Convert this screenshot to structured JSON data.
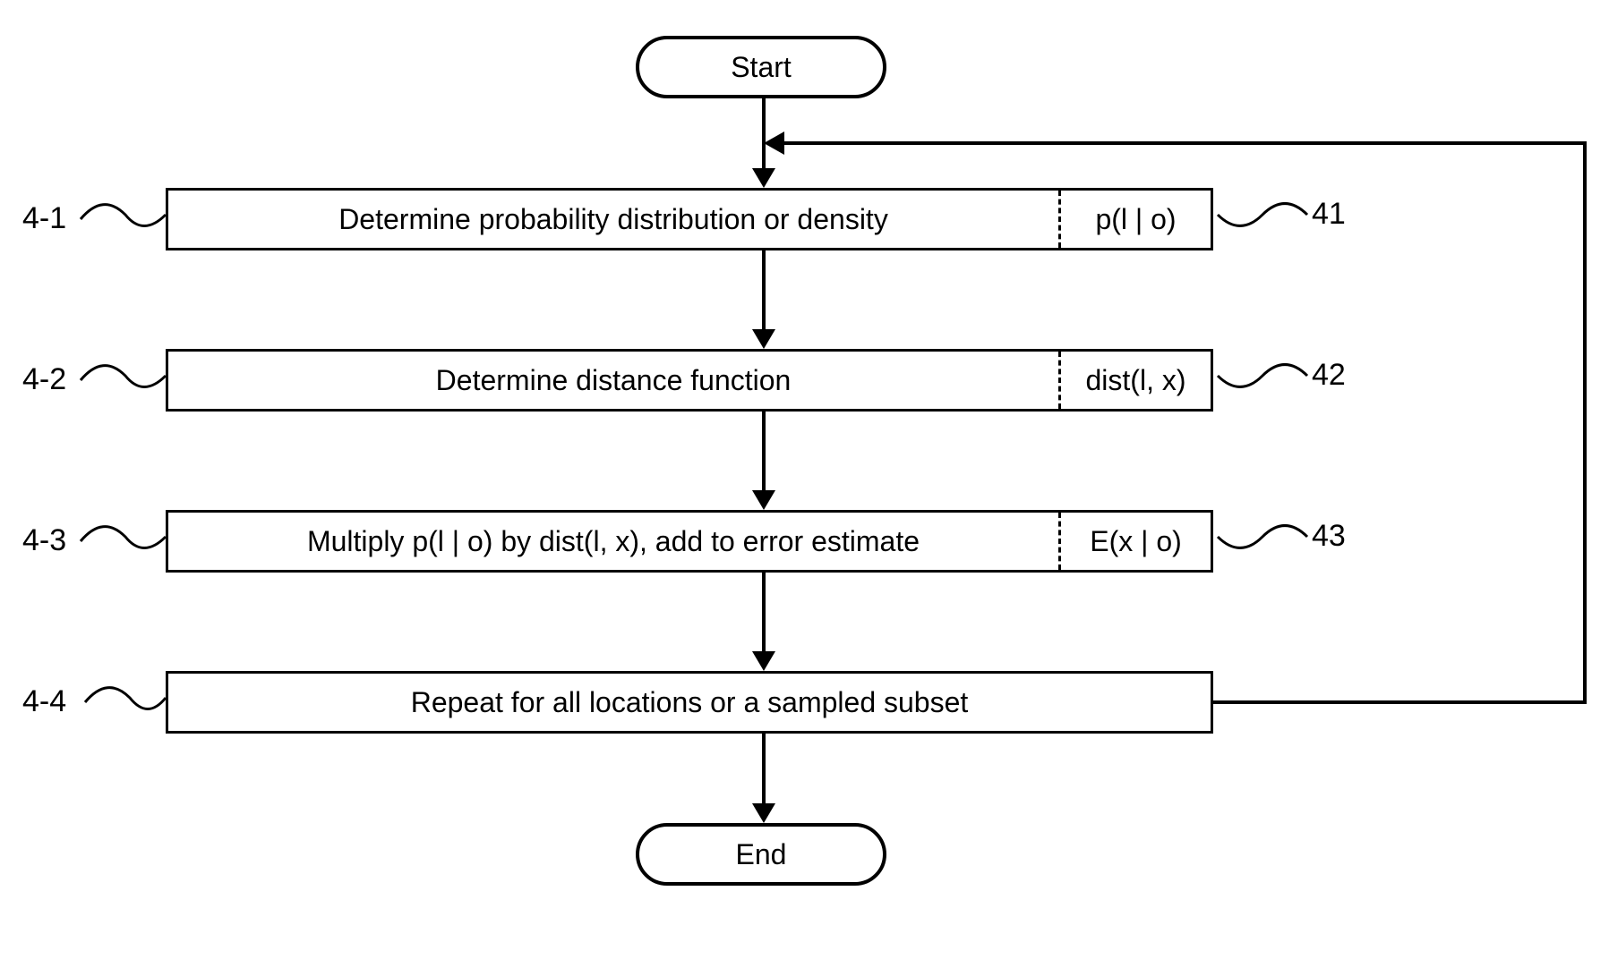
{
  "terminals": {
    "start": "Start",
    "end": "End"
  },
  "steps": [
    {
      "left_label": "4-1",
      "main": "Determine probability distribution or density",
      "side": "p(l | o)",
      "right_label": "41"
    },
    {
      "left_label": "4-2",
      "main": "Determine distance function",
      "side": "dist(l, x)",
      "right_label": "42"
    },
    {
      "left_label": "4-3",
      "main": "Multiply p(l | o) by dist(l, x), add to error estimate",
      "side": "E(x | o)",
      "right_label": "43"
    },
    {
      "left_label": "4-4",
      "main": "Repeat for all locations or a sampled subset",
      "side": null,
      "right_label": null
    }
  ]
}
